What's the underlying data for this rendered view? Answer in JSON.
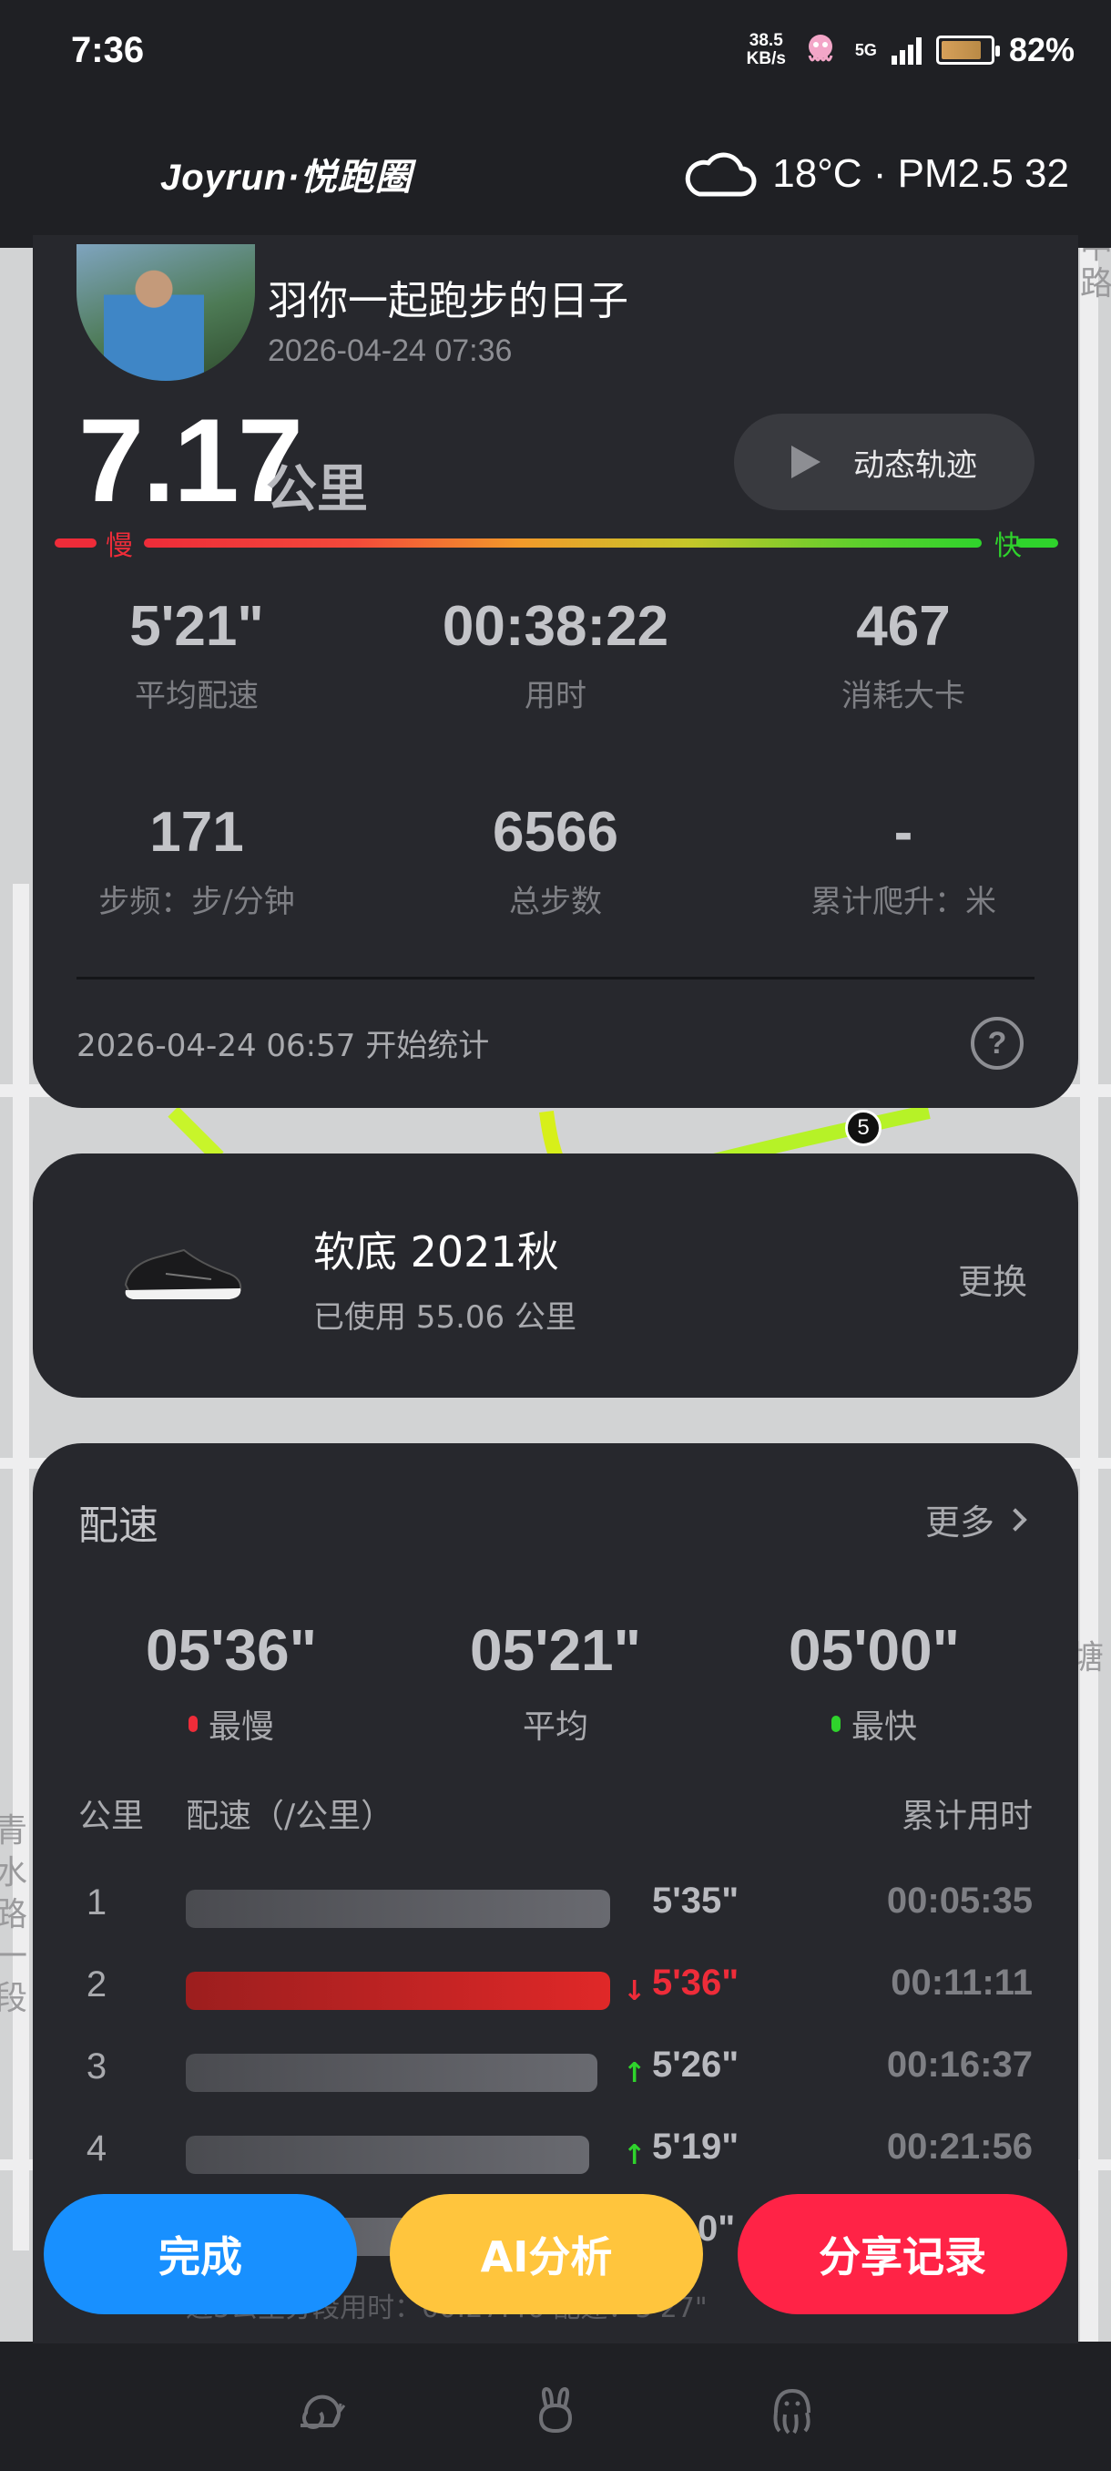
{
  "status_bar": {
    "time": "7:36",
    "net_speed_value": "38.5",
    "net_speed_unit": "KB/s",
    "network": "5G",
    "battery_percent": "82%",
    "battery_level": 0.82
  },
  "header": {
    "brand": "Joyrun·悦跑圈",
    "weather_icon": "cloud-icon",
    "weather_text": "18°C · PM2.5 32"
  },
  "run": {
    "user_name": "羽你一起跑步的日子",
    "date": "2026-04-24 07:36",
    "distance": "7.17",
    "distance_unit": "公里",
    "track_button": "动态轨迹",
    "speed_slow_label": "慢",
    "speed_fast_label": "快",
    "stats": [
      {
        "value": "5'21\"",
        "label": "平均配速"
      },
      {
        "value": "00:38:22",
        "label": "用时"
      },
      {
        "value": "467",
        "label": "消耗大卡"
      },
      {
        "value": "171",
        "label": "步频：步/分钟"
      },
      {
        "value": "6566",
        "label": "总步数"
      },
      {
        "value": "-",
        "label": "累计爬升：米"
      }
    ],
    "start_text": "2026-04-24 06:57  开始统计",
    "help_symbol": "?"
  },
  "map": {
    "km_marker": "5",
    "labels": [
      "中",
      "路",
      "塘",
      "青",
      "水",
      "路",
      "一",
      "段"
    ]
  },
  "shoe": {
    "name": "软底 2021秋",
    "usage": "已使用 55.06 公里",
    "change": "更换"
  },
  "pace": {
    "title": "配速",
    "more": "更多",
    "summary": [
      {
        "value": "05'36\"",
        "label": "最慢",
        "dot_color": "#ee2c39"
      },
      {
        "value": "05'21\"",
        "label": "平均",
        "dot_color": ""
      },
      {
        "value": "05'00\"",
        "label": "最快",
        "dot_color": "#2fd32c"
      }
    ],
    "headers": {
      "km": "公里",
      "pace": "配速（/公里）",
      "cum": "累计用时"
    },
    "rows": [
      {
        "km": "1",
        "pace": "5'35\"",
        "cum": "00:05:35",
        "arrow": "",
        "bar": 1.0,
        "slow": false
      },
      {
        "km": "2",
        "pace": "5'36\"",
        "cum": "00:11:11",
        "arrow": "↓",
        "bar": 1.0,
        "slow": true
      },
      {
        "km": "3",
        "pace": "5'26\"",
        "cum": "00:16:37",
        "arrow": "↑",
        "bar": 0.97,
        "slow": false
      },
      {
        "km": "4",
        "pace": "5'19\"",
        "cum": "00:21:56",
        "arrow": "↑",
        "bar": 0.95,
        "slow": false
      },
      {
        "km": "5",
        "pace": "0\"",
        "cum": "",
        "arrow": "",
        "bar": 0.55,
        "slow": false
      }
    ],
    "footer_partial": "近5公里分段用时：00:27:46   配速：5'27\""
  },
  "actions": {
    "done": "完成",
    "ai": "AI分析",
    "share": "分享记录"
  },
  "nav": {
    "icons": [
      "snail-icon",
      "rabbit-icon",
      "octopus-icon"
    ]
  }
}
